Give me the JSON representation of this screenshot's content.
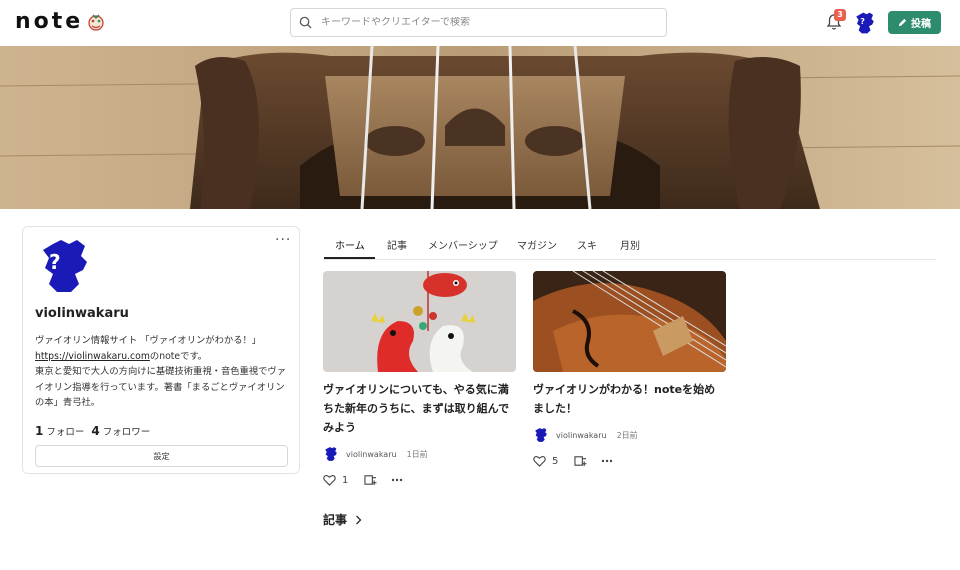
{
  "header": {
    "logo_text": "note",
    "search_placeholder": "キーワードやクリエイターで検索",
    "notification_count": "3",
    "post_label": "投稿"
  },
  "profile": {
    "name": "violinwakaru",
    "bio_line1": "ヴァイオリン情報サイト 「ヴァイオリンがわかる！」",
    "bio_link": "https://violinwakaru.com",
    "bio_link_suffix": "のnoteです。",
    "bio_line3": "東京と愛知で大人の方向けに基礎技術重視・音色重視でヴァイオリン指導を行っています。著書「まるごとヴァイオリンの本」青弓社。",
    "follow_count": "1",
    "follow_label": "フォロー",
    "follower_count": "4",
    "follower_label": "フォロワー",
    "settings_label": "設定",
    "more_label": "···"
  },
  "tabs": [
    {
      "label": "ホーム",
      "active": true
    },
    {
      "label": "記事"
    },
    {
      "label": "メンバーシップ"
    },
    {
      "label": "マガジン"
    },
    {
      "label": "スキ"
    },
    {
      "label": "月別"
    }
  ],
  "articles": [
    {
      "title": "ヴァイオリンについても、やる気に満ちた新年のうちに、まずは取り組んでみよう",
      "author": "violinwakaru",
      "time": "1日前",
      "likes": "1"
    },
    {
      "title": "ヴァイオリンがわかる！noteを始めました！",
      "author": "violinwakaru",
      "time": "2日前",
      "likes": "5"
    }
  ],
  "section": {
    "title": "記事"
  },
  "colors": {
    "accent_green": "#2d8c6e",
    "badge_red": "#e8614f",
    "avatar_blue": "#1a1ab8"
  }
}
